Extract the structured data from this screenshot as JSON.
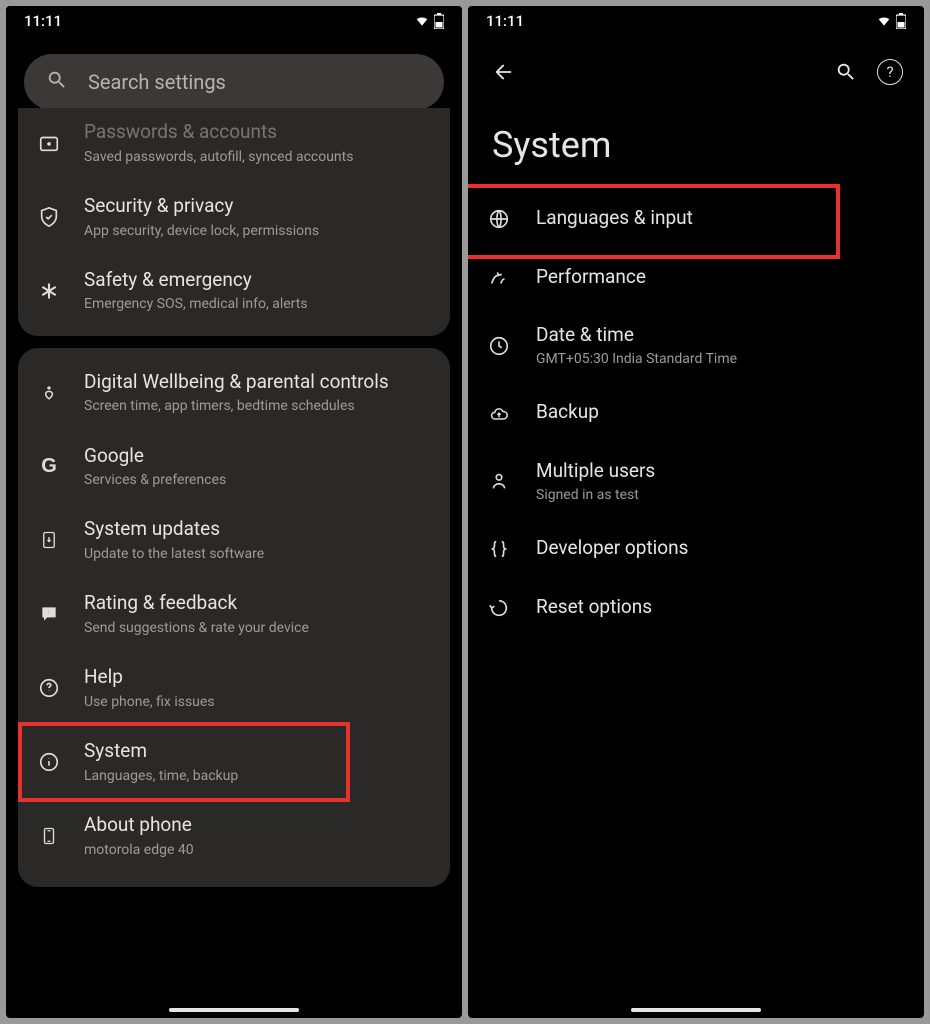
{
  "status": {
    "time": "11:11"
  },
  "left": {
    "search_placeholder": "Search settings",
    "group1": [
      {
        "icon": "key",
        "title": "Passwords & accounts",
        "sub": "Saved passwords, autofill, synced accounts"
      },
      {
        "icon": "shield",
        "title": "Security & privacy",
        "sub": "App security, device lock, permissions"
      },
      {
        "icon": "asterisk",
        "title": "Safety & emergency",
        "sub": "Emergency SOS, medical info, alerts"
      }
    ],
    "group2": [
      {
        "icon": "heart",
        "title": "Digital Wellbeing & parental controls",
        "sub": "Screen time, app timers, bedtime schedules"
      },
      {
        "icon": "google",
        "title": "Google",
        "sub": "Services & preferences"
      },
      {
        "icon": "update",
        "title": "System updates",
        "sub": "Update to the latest software"
      },
      {
        "icon": "feedback",
        "title": "Rating & feedback",
        "sub": "Send suggestions & rate your device"
      },
      {
        "icon": "help",
        "title": "Help",
        "sub": "Use phone, fix issues"
      },
      {
        "icon": "info",
        "title": "System",
        "sub": "Languages, time, backup",
        "highlighted": true
      },
      {
        "icon": "phone",
        "title": "About phone",
        "sub": "motorola edge 40"
      }
    ]
  },
  "right": {
    "page_title": "System",
    "items": [
      {
        "icon": "globe",
        "title": "Languages & input",
        "sub": "",
        "highlighted": true
      },
      {
        "icon": "perf",
        "title": "Performance",
        "sub": ""
      },
      {
        "icon": "clock",
        "title": "Date & time",
        "sub": "GMT+05:30 India Standard Time"
      },
      {
        "icon": "cloud",
        "title": "Backup",
        "sub": ""
      },
      {
        "icon": "users",
        "title": "Multiple users",
        "sub": "Signed in as test"
      },
      {
        "icon": "braces",
        "title": "Developer options",
        "sub": ""
      },
      {
        "icon": "reset",
        "title": "Reset options",
        "sub": ""
      }
    ]
  }
}
